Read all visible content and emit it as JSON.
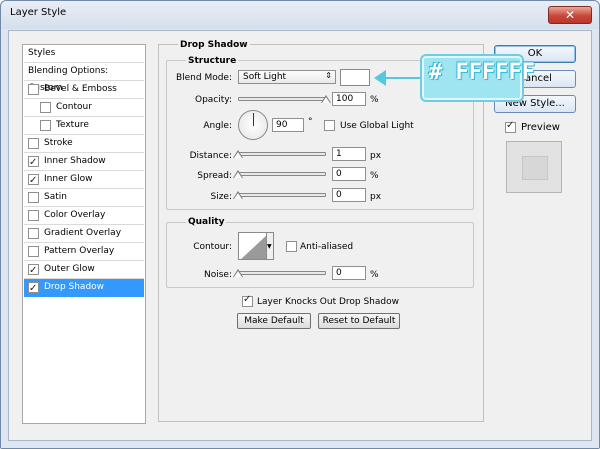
{
  "window": {
    "title": "Layer Style",
    "close_glyph": "✕"
  },
  "styles_list": [
    {
      "label": "Styles",
      "checkbox": false,
      "checked": false,
      "indent": 0,
      "selected": false
    },
    {
      "label": "Blending Options: Custom",
      "checkbox": false,
      "checked": false,
      "indent": 0,
      "selected": false
    },
    {
      "label": "Bevel & Emboss",
      "checkbox": true,
      "checked": false,
      "indent": 0,
      "selected": false
    },
    {
      "label": "Contour",
      "checkbox": true,
      "checked": false,
      "indent": 1,
      "selected": false
    },
    {
      "label": "Texture",
      "checkbox": true,
      "checked": false,
      "indent": 1,
      "selected": false
    },
    {
      "label": "Stroke",
      "checkbox": true,
      "checked": false,
      "indent": 0,
      "selected": false
    },
    {
      "label": "Inner Shadow",
      "checkbox": true,
      "checked": true,
      "indent": 0,
      "selected": false
    },
    {
      "label": "Inner Glow",
      "checkbox": true,
      "checked": true,
      "indent": 0,
      "selected": false
    },
    {
      "label": "Satin",
      "checkbox": true,
      "checked": false,
      "indent": 0,
      "selected": false
    },
    {
      "label": "Color Overlay",
      "checkbox": true,
      "checked": false,
      "indent": 0,
      "selected": false
    },
    {
      "label": "Gradient Overlay",
      "checkbox": true,
      "checked": false,
      "indent": 0,
      "selected": false
    },
    {
      "label": "Pattern Overlay",
      "checkbox": true,
      "checked": false,
      "indent": 0,
      "selected": false
    },
    {
      "label": "Outer Glow",
      "checkbox": true,
      "checked": true,
      "indent": 0,
      "selected": false
    },
    {
      "label": "Drop Shadow",
      "checkbox": true,
      "checked": true,
      "indent": 0,
      "selected": true
    }
  ],
  "drop_shadow": {
    "section_title": "Drop Shadow",
    "structure_title": "Structure",
    "blend_mode": {
      "label": "Blend Mode:",
      "value": "Soft Light",
      "color": "#ffffff"
    },
    "opacity": {
      "label": "Opacity:",
      "value": "100",
      "unit": "%",
      "level": 100
    },
    "angle": {
      "label": "Angle:",
      "value": "90",
      "unit": "°",
      "use_global_light": "Use Global Light",
      "global_checked": false
    },
    "distance": {
      "label": "Distance:",
      "value": "1",
      "unit": "px",
      "level": 0
    },
    "spread": {
      "label": "Spread:",
      "value": "0",
      "unit": "%",
      "level": 0
    },
    "size": {
      "label": "Size:",
      "value": "0",
      "unit": "px",
      "level": 0
    },
    "quality_title": "Quality",
    "contour": {
      "label": "Contour:",
      "anti_aliased": "Anti-aliased",
      "anti_checked": false
    },
    "noise": {
      "label": "Noise:",
      "value": "0",
      "unit": "%",
      "level": 0
    },
    "knocks_out": {
      "label": "Layer Knocks Out Drop Shadow",
      "checked": true
    },
    "make_default": "Make Default",
    "reset_default": "Reset to Default"
  },
  "side_buttons": {
    "ok": "OK",
    "cancel": "Cancel",
    "new_style": "New Style...",
    "preview": "Preview",
    "preview_checked": true
  },
  "annotation": {
    "text": "# FFFFFF"
  }
}
